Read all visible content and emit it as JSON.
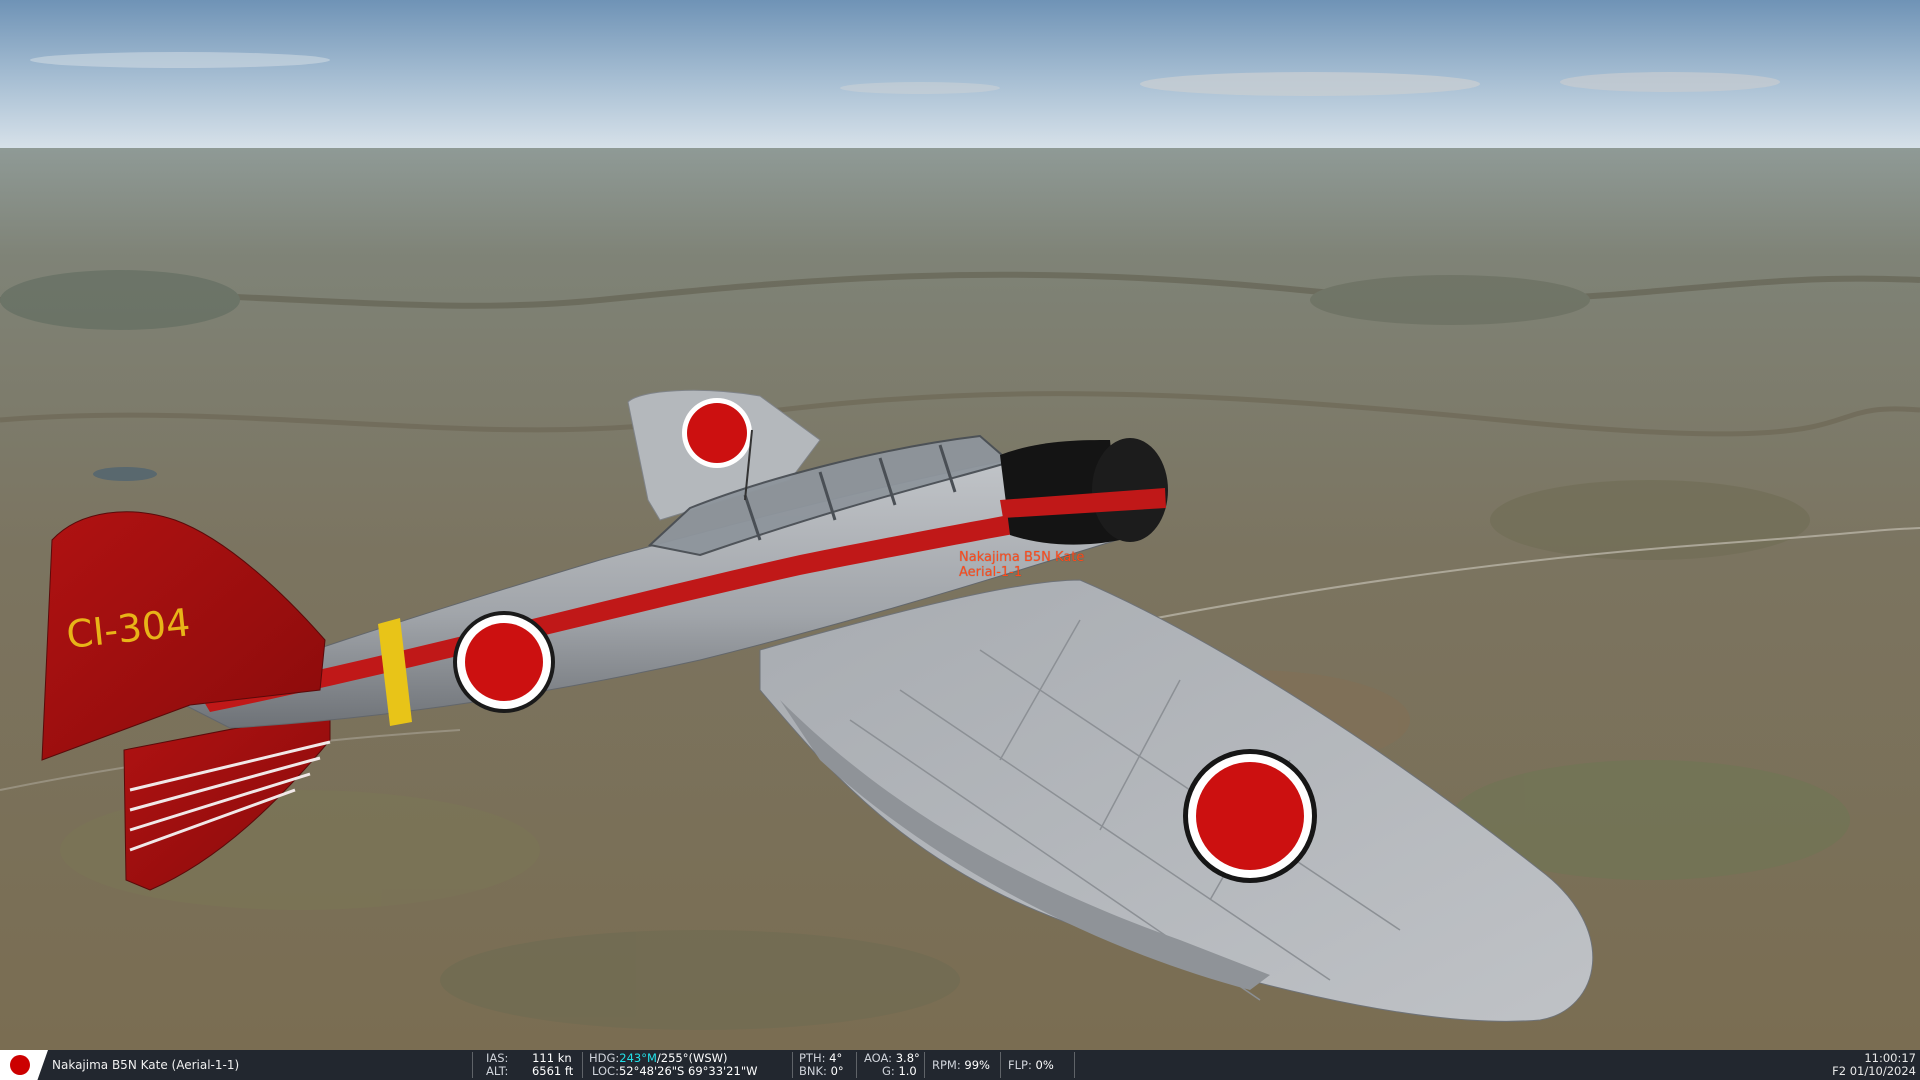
{
  "game_view": {
    "aircraft_label": {
      "name": "Nakajima B5N Kate",
      "group": "Aerial-1-1"
    },
    "tail_code": "CI-304",
    "colors": {
      "sky_top": "#6f93b6",
      "sky_horizon": "#d6e1ea",
      "terrain": "#7b7257",
      "fuselage_silver": "#a9adb2",
      "stripe_red": "#c01818",
      "label_orange": "#ff4a1a"
    }
  },
  "status_bar": {
    "country_icon": "japan-flag-icon",
    "unit": "Nakajima B5N Kate (Aerial-1-1)",
    "ias_label": "IAS:",
    "ias_value": "111 kn",
    "alt_label": "ALT:",
    "alt_value": "6561 ft",
    "hdg_label": "HDG:",
    "hdg_mag": "243°M",
    "hdg_true": "/255°(WSW)",
    "loc_label": "LOC:",
    "loc_value": "52°48'26\"S 69°33'21\"W",
    "pth_label": "PTH:",
    "pth_value": "4°",
    "bnk_label": "BNK:",
    "bnk_value": "0°",
    "aoa_label": "AOA:",
    "aoa_value": "3.8°",
    "g_label": "G:",
    "g_value": "1.0",
    "rpm_label": "RPM:",
    "rpm_value": "99%",
    "flp_label": "FLP:",
    "flp_value": "0%",
    "time": "11:00:17",
    "date": "F2 01/10/2024"
  }
}
